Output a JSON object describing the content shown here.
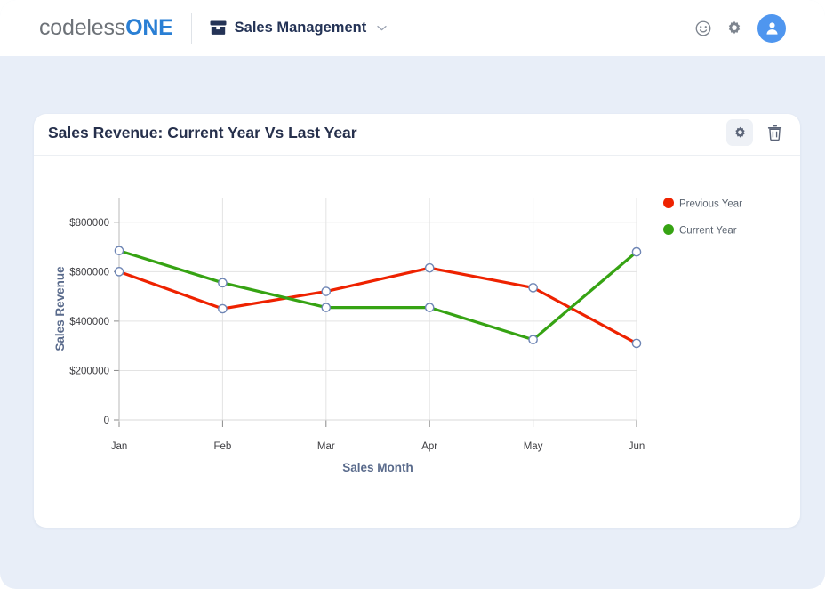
{
  "topbar": {
    "brand_light": "codeless",
    "brand_bold": "ONE",
    "app_menu_label": "Sales Management",
    "app_menu_icon": "archive-box-icon",
    "chevron": "⌄",
    "icons": [
      {
        "name": "smiley-icon"
      },
      {
        "name": "gear-icon"
      },
      {
        "name": "user-avatar-icon"
      }
    ],
    "avatar_color": "#4f96ef"
  },
  "card": {
    "title": "Sales Revenue: Current Year Vs Last Year",
    "actions": [
      {
        "name": "settings-button",
        "icon": "gear-icon"
      },
      {
        "name": "delete-button",
        "icon": "trash-icon"
      }
    ]
  },
  "chart_data": {
    "type": "line",
    "title": "Sales Revenue: Current Year Vs Last Year",
    "xlabel": "Sales Month",
    "ylabel": "Sales Revenue",
    "categories": [
      "Jan",
      "Feb",
      "Mar",
      "Apr",
      "May",
      "Jun"
    ],
    "ytick_labels": [
      "$800000",
      "$600000",
      "$400000",
      "$200000",
      "0"
    ],
    "ytick_values": [
      800000,
      600000,
      400000,
      200000,
      0
    ],
    "ylim": [
      0,
      900000
    ],
    "grid": true,
    "legend_position": "right",
    "series": [
      {
        "name": "Previous Year",
        "color": "#ee2200",
        "values": [
          600000,
          450000,
          520000,
          615000,
          535000,
          310000
        ]
      },
      {
        "name": "Current Year",
        "color": "#36a313",
        "values": [
          685000,
          555000,
          455000,
          455000,
          325000,
          680000
        ]
      }
    ],
    "marker": {
      "fill": "#ffffff",
      "stroke": "#6f86b5"
    }
  },
  "page": {
    "background": "#e8eef8"
  }
}
